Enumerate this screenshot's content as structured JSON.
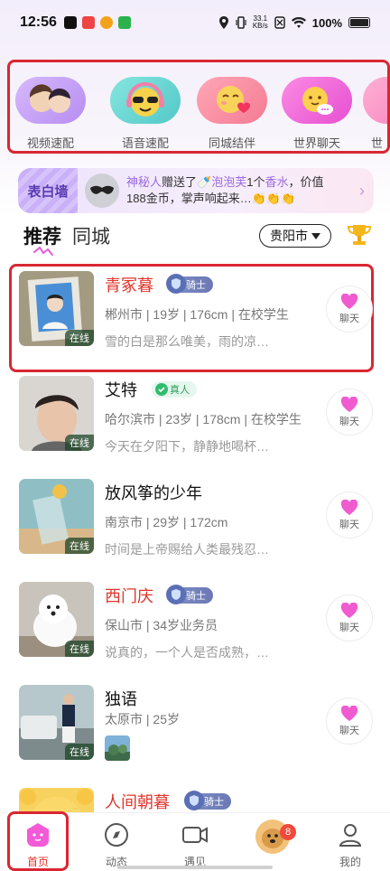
{
  "status_bar": {
    "time": "12:56",
    "speed_top": "33.1",
    "speed_bottom": "KB/s",
    "battery": "100%"
  },
  "quick_entries": [
    {
      "label": "视频速配",
      "icon": "video-match-icon",
      "color": "#c9a6f7"
    },
    {
      "label": "语音速配",
      "icon": "voice-match-icon",
      "color": "#6fd8d4"
    },
    {
      "label": "同城结伴",
      "icon": "local-companion-icon",
      "color": "#f89aa8"
    },
    {
      "label": "世界聊天",
      "icon": "world-chat-icon",
      "color": "#f07ad8"
    },
    {
      "label": "世",
      "icon": "more-icon",
      "color": "#f7a3cf"
    }
  ],
  "banner": {
    "tag": "表白墙",
    "user": "神秘人",
    "text_1": "赠送了",
    "gift": "泡泡芙",
    "text_2": "1个",
    "gift2": "香水",
    "text_3": "，价值",
    "line2": "188金币，掌声响起来…👏👏👏"
  },
  "tabs": {
    "recommend": "推荐",
    "local": "同城",
    "city": "贵阳市"
  },
  "users": [
    {
      "name": "青冢暮",
      "red": true,
      "badge": "骑士",
      "badge_type": "knight",
      "info": "郴州市 | 19岁 | 176cm | 在校学生",
      "signature": "雪的白是那么唯美，雨的凉…",
      "online": "在线",
      "chat": "聊天"
    },
    {
      "name": "艾特",
      "red": false,
      "badge": "真人",
      "badge_type": "real",
      "info": "哈尔滨市 | 23岁 | 178cm | 在校学生",
      "signature": "今天在夕阳下，静静地喝杯…",
      "online": "在线",
      "chat": "聊天"
    },
    {
      "name": "放风筝的少年",
      "red": false,
      "badge": "",
      "badge_type": "",
      "info": "南京市 | 29岁 | 172cm",
      "signature": "时间是上帝赐给人类最残忍…",
      "online": "在线",
      "chat": "聊天"
    },
    {
      "name": "西门庆",
      "red": true,
      "badge": "骑士",
      "badge_type": "knight",
      "info": "保山市 | 34岁业务员",
      "signature": "说真的，一个人是否成熟，…",
      "online": "在线",
      "chat": "聊天"
    },
    {
      "name": "独语",
      "red": false,
      "badge": "",
      "badge_type": "",
      "info": "太原市 | 25岁",
      "signature": "",
      "online": "在线",
      "chat": "聊天"
    },
    {
      "name": "人间朝暮",
      "red": true,
      "badge": "骑士",
      "badge_type": "knight",
      "info": "",
      "signature": "",
      "online": "",
      "chat": ""
    }
  ],
  "bottom_nav": [
    {
      "label": "首页",
      "icon": "home-icon"
    },
    {
      "label": "动态",
      "icon": "compass-icon"
    },
    {
      "label": "遇见",
      "icon": "video-camera-icon"
    },
    {
      "label": "",
      "icon": "match-avatar-icon",
      "count": "8"
    },
    {
      "label": "我的",
      "icon": "profile-icon"
    }
  ],
  "colors": {
    "accent_red": "#e0352b",
    "highlight_box": "#d92732",
    "heart": "#f05bd0"
  }
}
